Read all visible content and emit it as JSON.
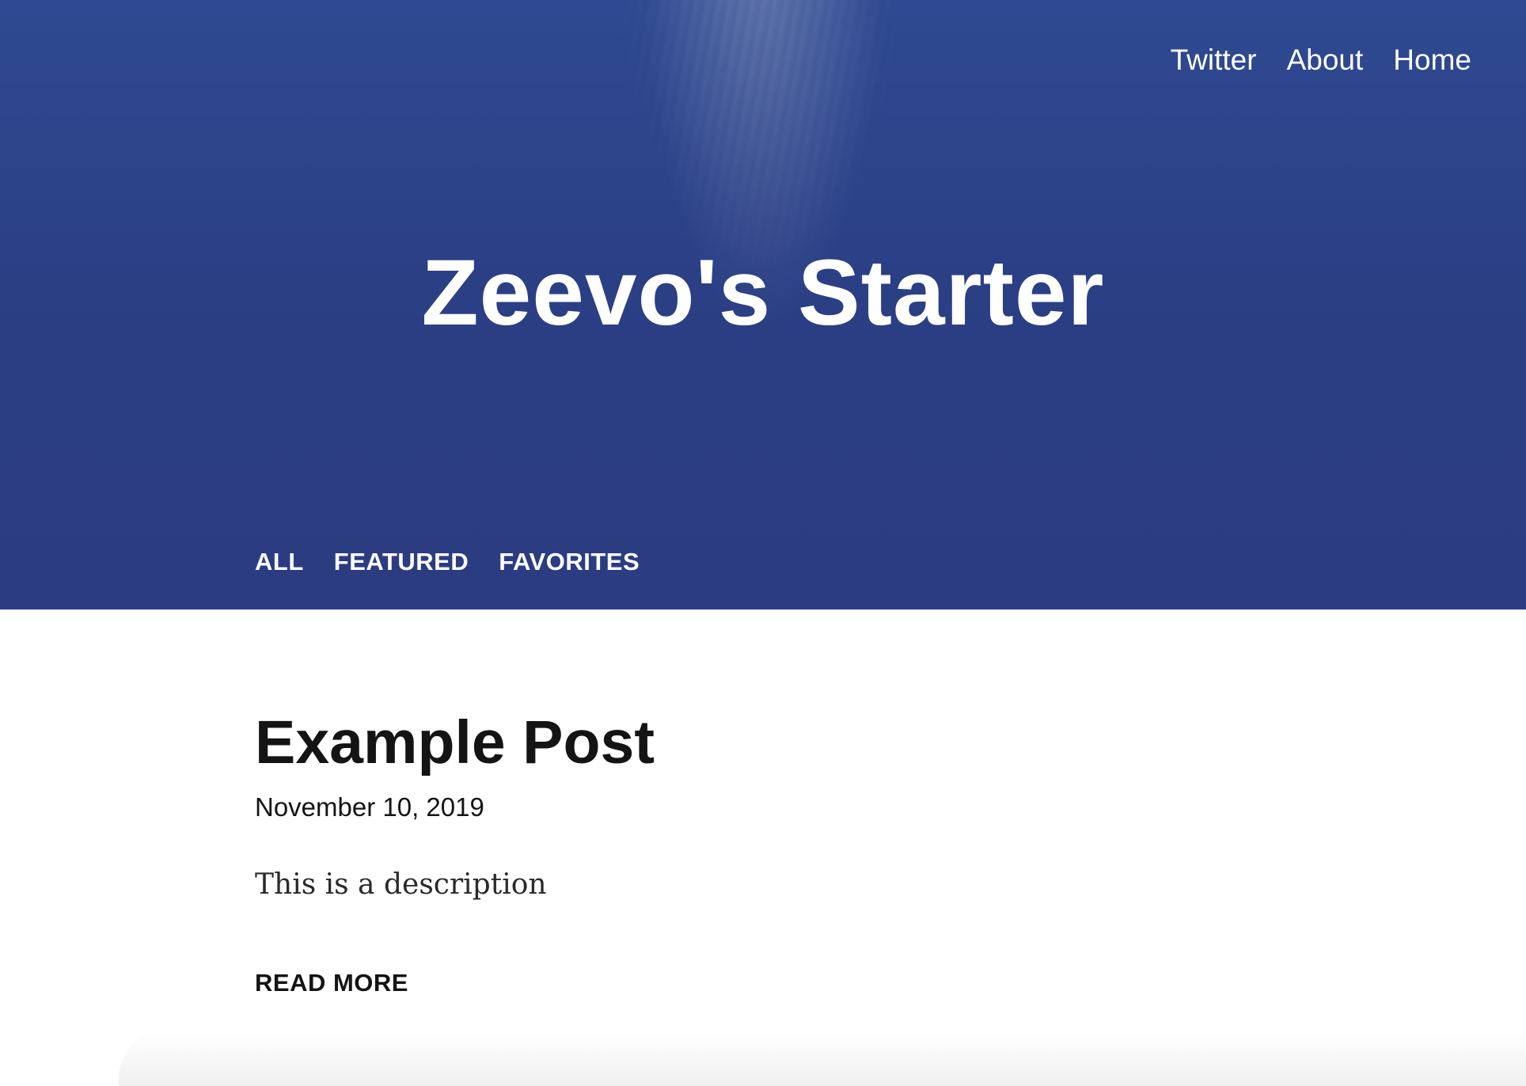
{
  "header": {
    "nav": [
      {
        "label": "Twitter"
      },
      {
        "label": "About"
      },
      {
        "label": "Home"
      }
    ],
    "site_title": "Zeevo's Starter",
    "filters": [
      {
        "label": "ALL"
      },
      {
        "label": "FEATURED"
      },
      {
        "label": "FAVORITES"
      }
    ],
    "colors": {
      "hero_background": "#2c3f85",
      "text": "#ffffff"
    }
  },
  "post": {
    "title": "Example Post",
    "date": "November 10, 2019",
    "description": "This is a description",
    "read_more_label": "READ MORE"
  }
}
